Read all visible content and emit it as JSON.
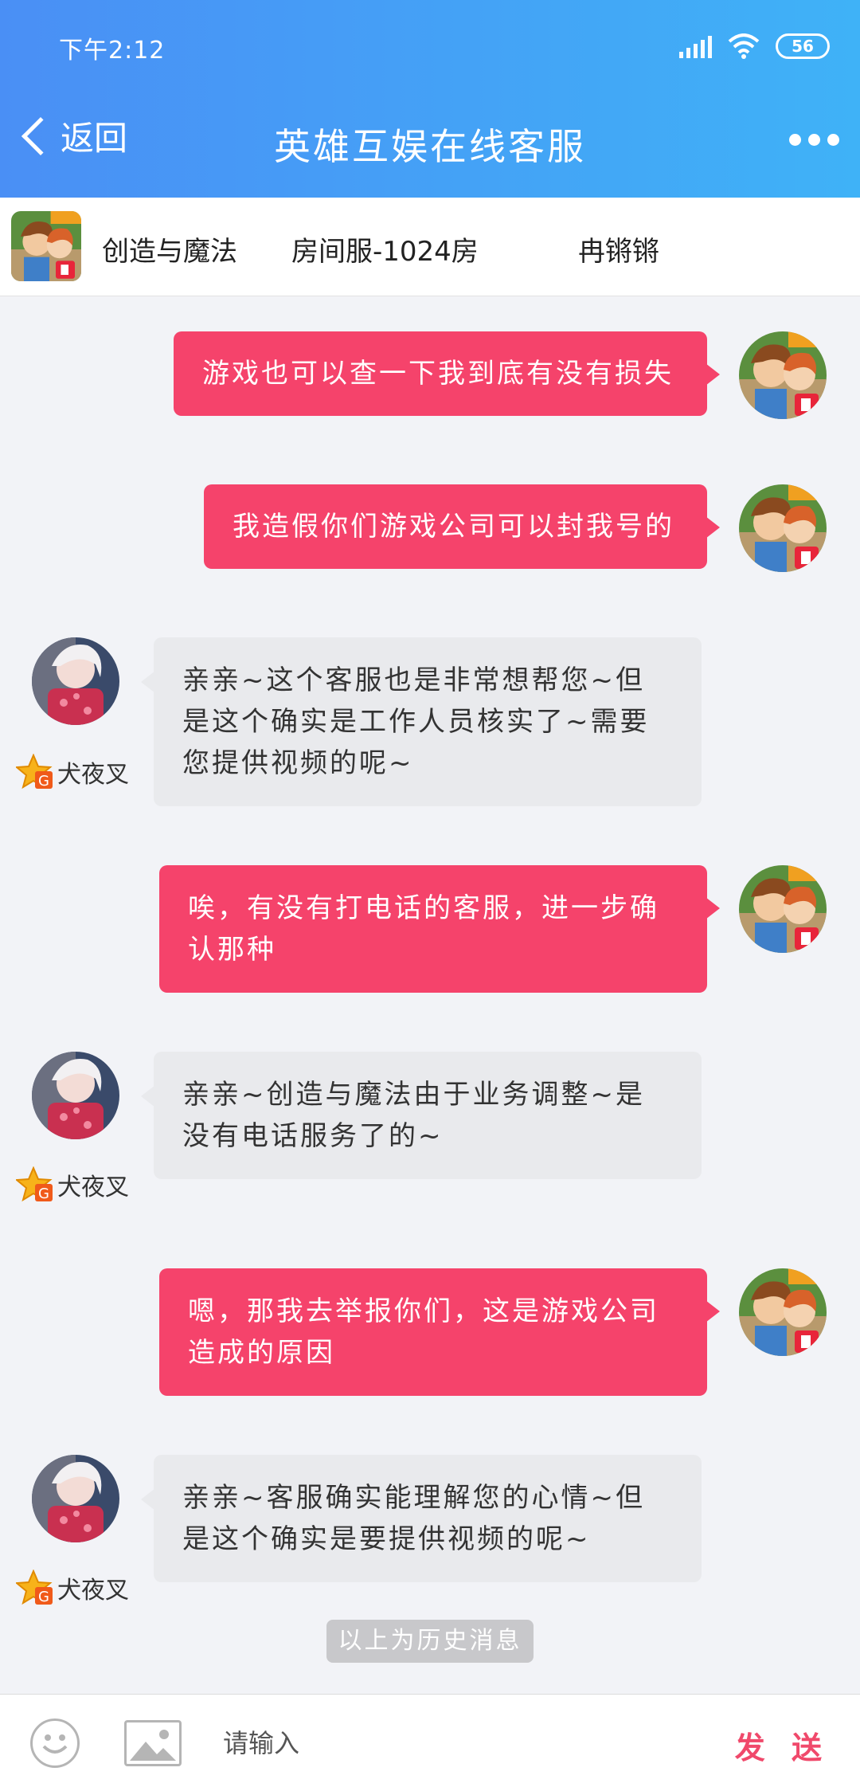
{
  "status_bar": {
    "time": "下午2:12",
    "battery": "56"
  },
  "header": {
    "back_label": "返回",
    "title": "英雄互娱在线客服"
  },
  "info_bar": {
    "game": "创造与魔法",
    "server": "房间服-1024房",
    "user": "冉锵锵"
  },
  "agent": {
    "name": "犬夜叉",
    "badge": "G"
  },
  "messages": [
    {
      "from": "me",
      "text": "游戏也可以查一下我到底有没有损失"
    },
    {
      "from": "me",
      "text": "我造假你们游戏公司可以封我号的"
    },
    {
      "from": "cs",
      "text": "亲亲~这个客服也是非常想帮您~但是这个确实是工作人员核实了~需要您提供视频的呢~"
    },
    {
      "from": "me",
      "text": "唉，有没有打电话的客服，进一步确认那种"
    },
    {
      "from": "cs",
      "text": "亲亲~创造与魔法由于业务调整~是没有电话服务了的~"
    },
    {
      "from": "me",
      "text": "嗯，那我去举报你们，这是游戏公司造成的原因"
    },
    {
      "from": "cs",
      "text": "亲亲~客服确实能理解您的心情~但是这个确实是要提供视频的呢~"
    }
  ],
  "history_tip": "以上为历史消息",
  "input": {
    "placeholder": "请输入",
    "send_label": "发 送"
  },
  "icons": {
    "back": "chevron-left-icon",
    "more": "more-dots-icon",
    "emoji": "smiley-face-icon",
    "image": "image-icon",
    "signal": "signal-icon",
    "wifi": "wifi-icon",
    "battery": "battery-icon"
  },
  "colors": {
    "header_start": "#4a8ff5",
    "header_end": "#3fb2f7",
    "user_bubble": "#f5436b",
    "agent_bubble": "#e9eaed",
    "send": "#f0496b"
  }
}
